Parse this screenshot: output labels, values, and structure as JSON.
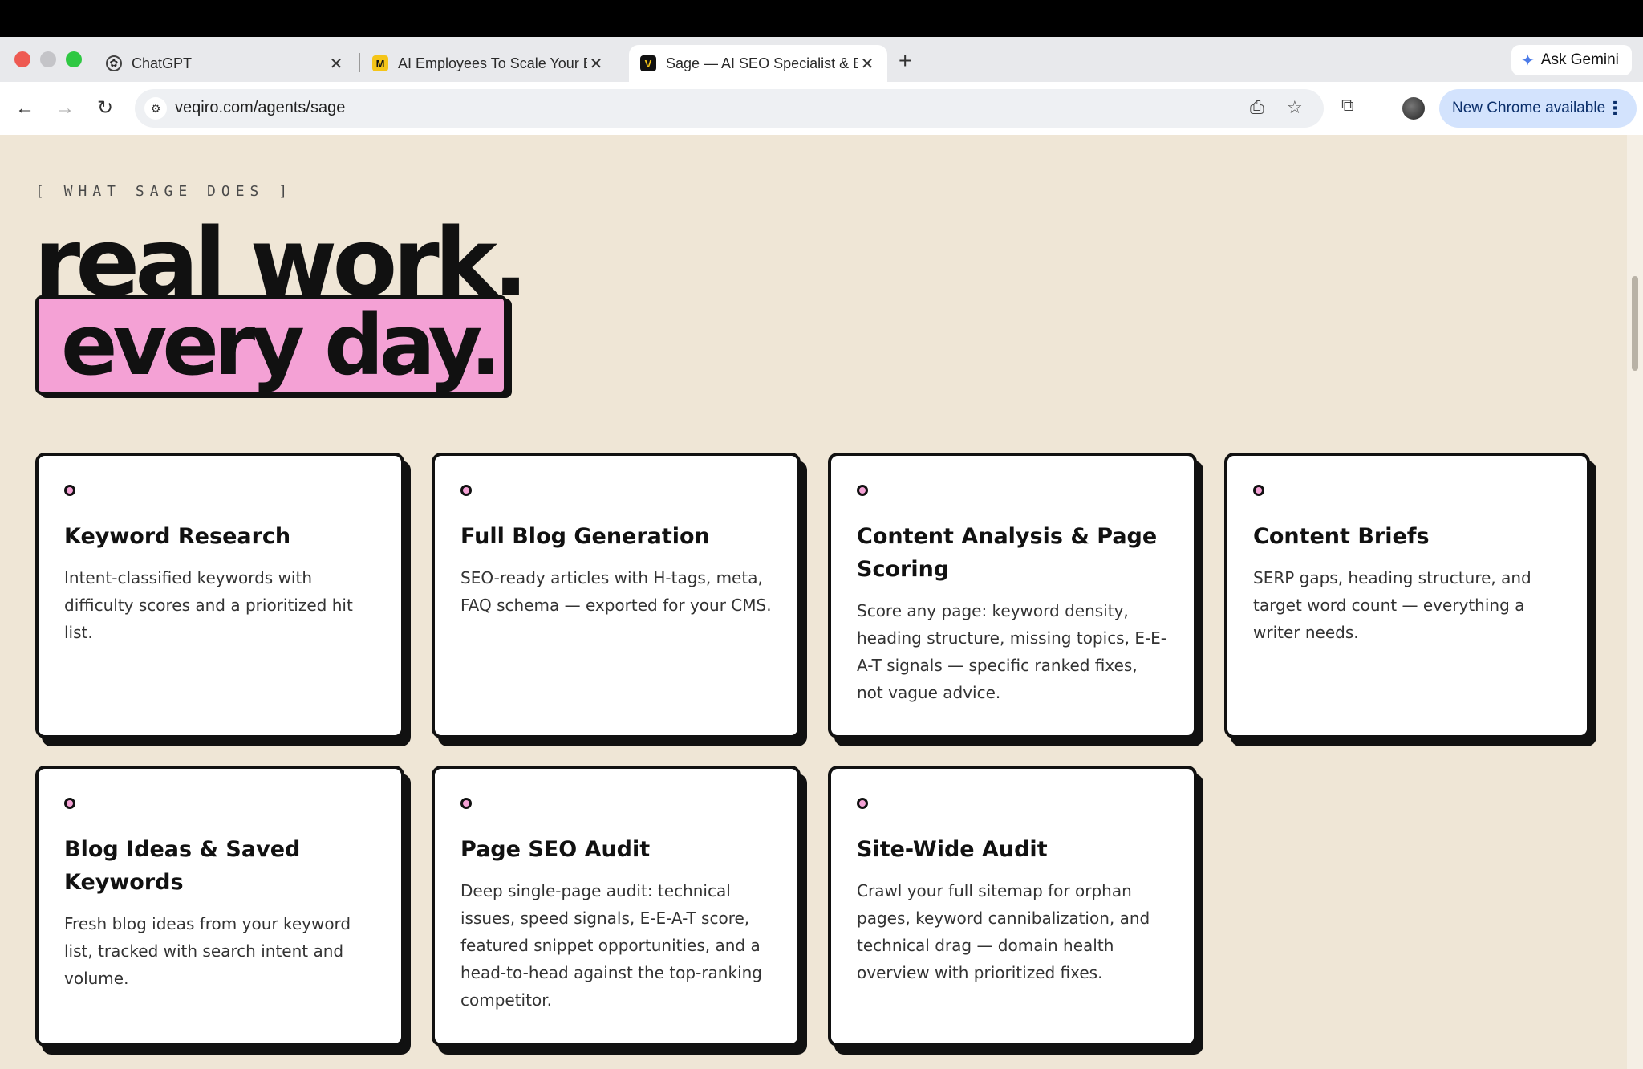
{
  "browser": {
    "tabs": [
      {
        "title": "ChatGPT",
        "favicon": "chatgpt-icon"
      },
      {
        "title": "AI Employees To Scale Your B",
        "favicon": "veqiro-m-icon"
      },
      {
        "title": "Sage — AI SEO Specialist & B",
        "favicon": "veqiro-v-icon",
        "active": true
      }
    ],
    "ask_gemini": "Ask Gemini",
    "url": "veqiro.com/agents/sage",
    "update_label": "New Chrome available"
  },
  "section": {
    "eyebrow": "[ WHAT SAGE DOES ]",
    "headline_line1": "real work.",
    "headline_line2": "every day."
  },
  "cards": [
    {
      "title": "Keyword Research",
      "desc": "Intent-classified keywords with difficulty scores and a prioritized hit list."
    },
    {
      "title": "Full Blog Generation",
      "desc": "SEO-ready articles with H-tags, meta, FAQ schema — exported for your CMS."
    },
    {
      "title": "Content Analysis & Page Scoring",
      "desc": "Score any page: keyword density, heading structure, missing topics, E-E-A-T signals — specific ranked fixes, not vague advice."
    },
    {
      "title": "Content Briefs",
      "desc": "SERP gaps, heading structure, and target word count — everything a writer needs."
    },
    {
      "title": "Blog Ideas & Saved Keywords",
      "desc": "Fresh blog ideas from your keyword list, tracked with search intent and volume."
    },
    {
      "title": "Page SEO Audit",
      "desc": "Deep single-page audit: technical issues, speed signals, E-E-A-T score, featured snippet opportunities, and a head-to-head against the top-ranking competitor."
    },
    {
      "title": "Site-Wide Audit",
      "desc": "Crawl your full sitemap for orphan pages, keyword cannibalization, and technical drag — domain health overview with prioritized fixes."
    }
  ],
  "colors": {
    "accent_pink": "#f4a1d5",
    "page_bg": "#efe6d6"
  }
}
